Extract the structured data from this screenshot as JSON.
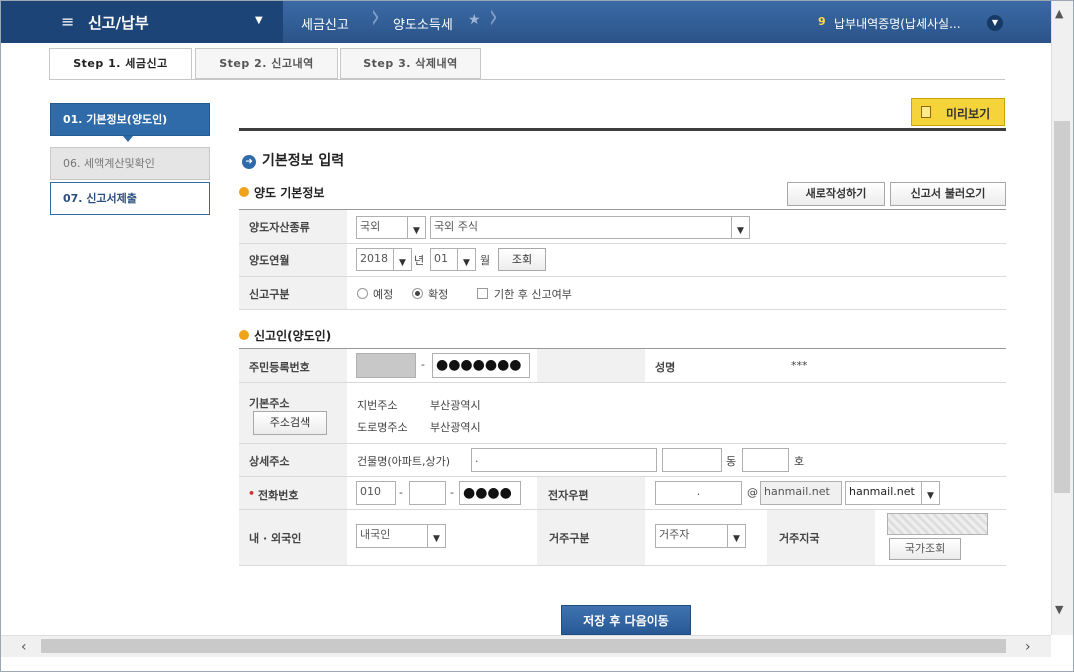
{
  "topbar": {
    "menu_icon": "hamburger-icon",
    "menu_title": "신고/납부",
    "crumb1": "세금신고",
    "crumb2": "양도소득세",
    "notice_count": "9",
    "notice_text": "납부내역증명(납세사실..."
  },
  "tabs": [
    "Step 1. 세금신고",
    "Step 2. 신고내역",
    "Step 3. 삭제내역"
  ],
  "sidebar": [
    "01. 기본정보(양도인)",
    "06. 세액계산및확인",
    "07. 신고서제출"
  ],
  "preview_label": "미리보기",
  "section_title": "기본정보 입력",
  "transfer": {
    "heading": "양도 기본정보",
    "new_btn": "새로작성하기",
    "load_btn": "신고서 불러오기",
    "asset_label": "양도자산종류",
    "asset_type": "국외",
    "asset_detail": "국외 주식",
    "period_label": "양도연월",
    "year": "2018",
    "year_unit": "년",
    "month": "01",
    "month_unit": "월",
    "query_btn": "조회",
    "report_label": "신고구분",
    "radio1": "예정",
    "radio2": "확정",
    "late_label": "기한 후 신고여부"
  },
  "filer": {
    "heading": "신고인(양도인)",
    "rrn_label": "주민등록번호",
    "rrn_dash": "-",
    "rrn_back": "●●●●●●●",
    "name_label": "성명",
    "name_value": "***",
    "addr_label": "기본주소",
    "addr_search_btn": "주소검색",
    "jibun_label": "지번주소",
    "jibun_value": "부산광역시",
    "road_label": "도로명주소",
    "road_value": "부산광역시",
    "detail_label": "상세주소",
    "building_label": "건물명(아파트,상가)",
    "building_value": ".",
    "dong_label": "동",
    "ho_label": "호",
    "phone_required": "•",
    "phone_label": "전화번호",
    "phone1": "010",
    "phone_dash": "-",
    "phone3": "●●●●",
    "email_label": "전자우편",
    "email_local": ".",
    "at": "@",
    "email_domain": "hanmail.net",
    "email_select": "hanmail.net",
    "nationality_label": "내 · 외국인",
    "nationality_value": "내국인",
    "residence_label": "거주구분",
    "residence_value": "거주자",
    "country_label": "거주지국",
    "country_btn": "국가조회"
  },
  "save_btn": "저장 후 다음이동"
}
